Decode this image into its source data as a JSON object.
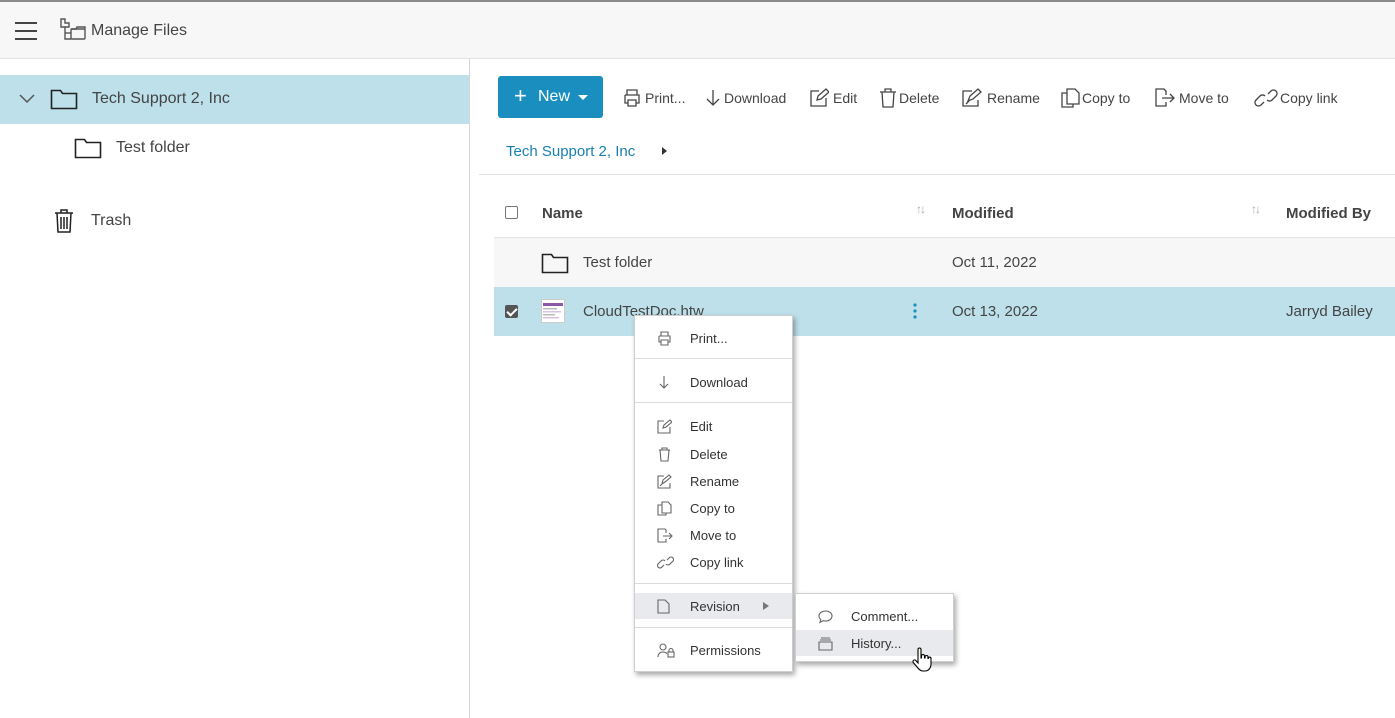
{
  "header": {
    "title": "Manage Files"
  },
  "sidebar": {
    "root": "Tech Support 2, Inc",
    "child": "Test folder",
    "trash": "Trash"
  },
  "toolbar": {
    "new_label": "New",
    "print": "Print...",
    "download": "Download",
    "edit": "Edit",
    "delete": "Delete",
    "rename": "Rename",
    "copy_to": "Copy to",
    "move_to": "Move to",
    "copy_link": "Copy link"
  },
  "breadcrumb": {
    "current": "Tech Support 2, Inc"
  },
  "table": {
    "columns": [
      "Name",
      "Modified",
      "Modified By"
    ],
    "rows": [
      {
        "name": "Test folder",
        "modified": "Oct 11, 2022",
        "modified_by": "",
        "selected": false
      },
      {
        "name": "CloudTestDoc.htw",
        "modified": "Oct 13, 2022",
        "modified_by": "Jarryd Bailey",
        "selected": true
      }
    ]
  },
  "context_menu": {
    "print": "Print...",
    "download": "Download",
    "edit": "Edit",
    "delete": "Delete",
    "rename": "Rename",
    "copy_to": "Copy to",
    "move_to": "Move to",
    "copy_link": "Copy link",
    "revision": "Revision",
    "permissions": "Permissions"
  },
  "submenu": {
    "comment": "Comment...",
    "history": "History..."
  },
  "colors": {
    "accent": "#1a8fbf",
    "selected_row": "#bde0ea",
    "link": "#1a7fae"
  }
}
